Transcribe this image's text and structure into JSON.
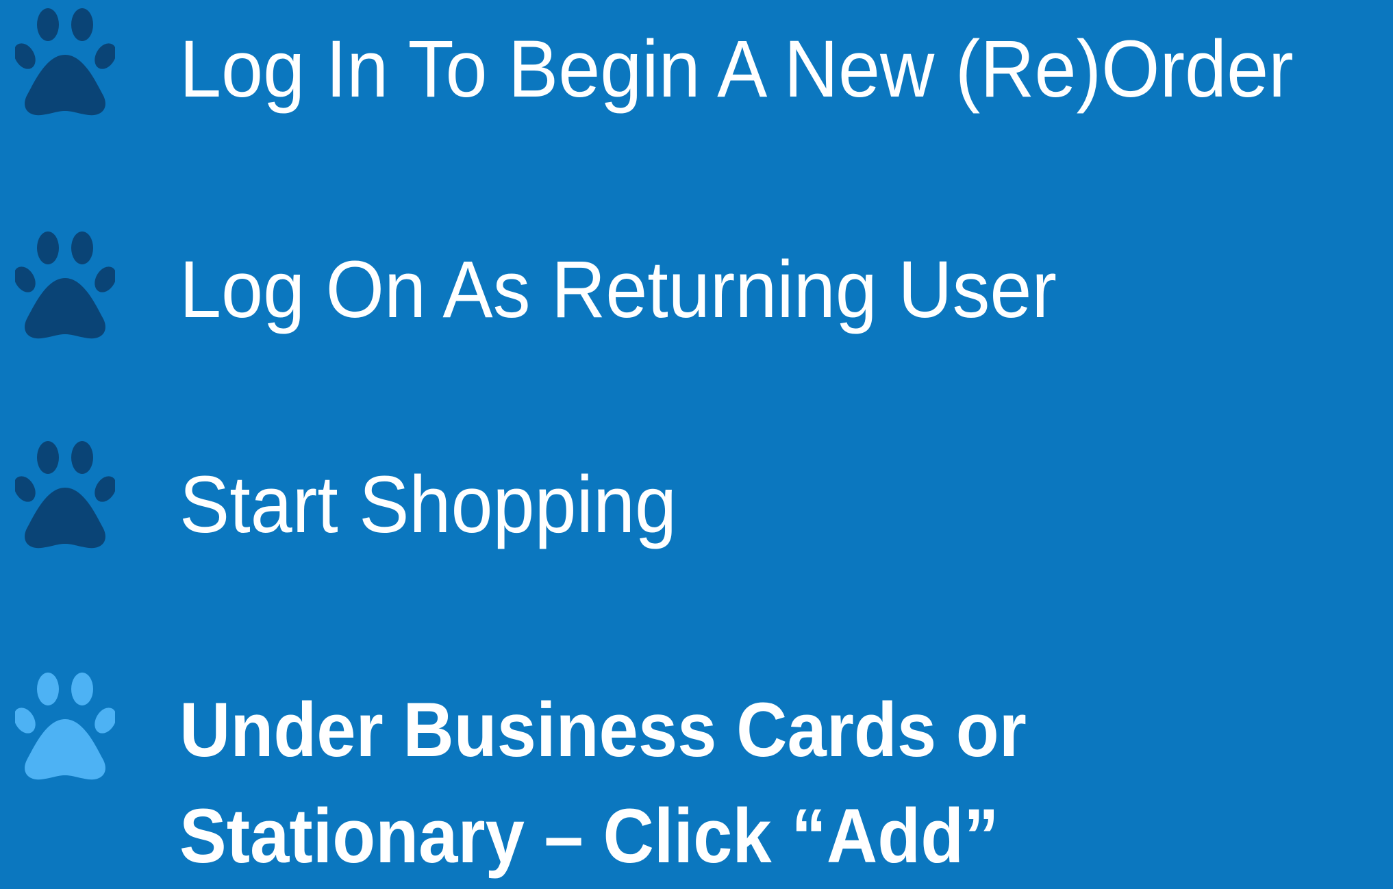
{
  "colors": {
    "background": "#0b77bf",
    "text": "#ffffff",
    "paw_done": "#0a4476",
    "paw_current": "#4db2f4"
  },
  "steps": [
    {
      "label": "Log In To Begin A New (Re)Order",
      "icon": "paw-icon",
      "state": "done"
    },
    {
      "label": "Log On As Returning User",
      "icon": "paw-icon",
      "state": "done"
    },
    {
      "label": "Start Shopping",
      "icon": "paw-icon",
      "state": "done"
    },
    {
      "label": "Under Business Cards or Stationary – Click “Add”",
      "icon": "paw-icon",
      "state": "current"
    }
  ]
}
